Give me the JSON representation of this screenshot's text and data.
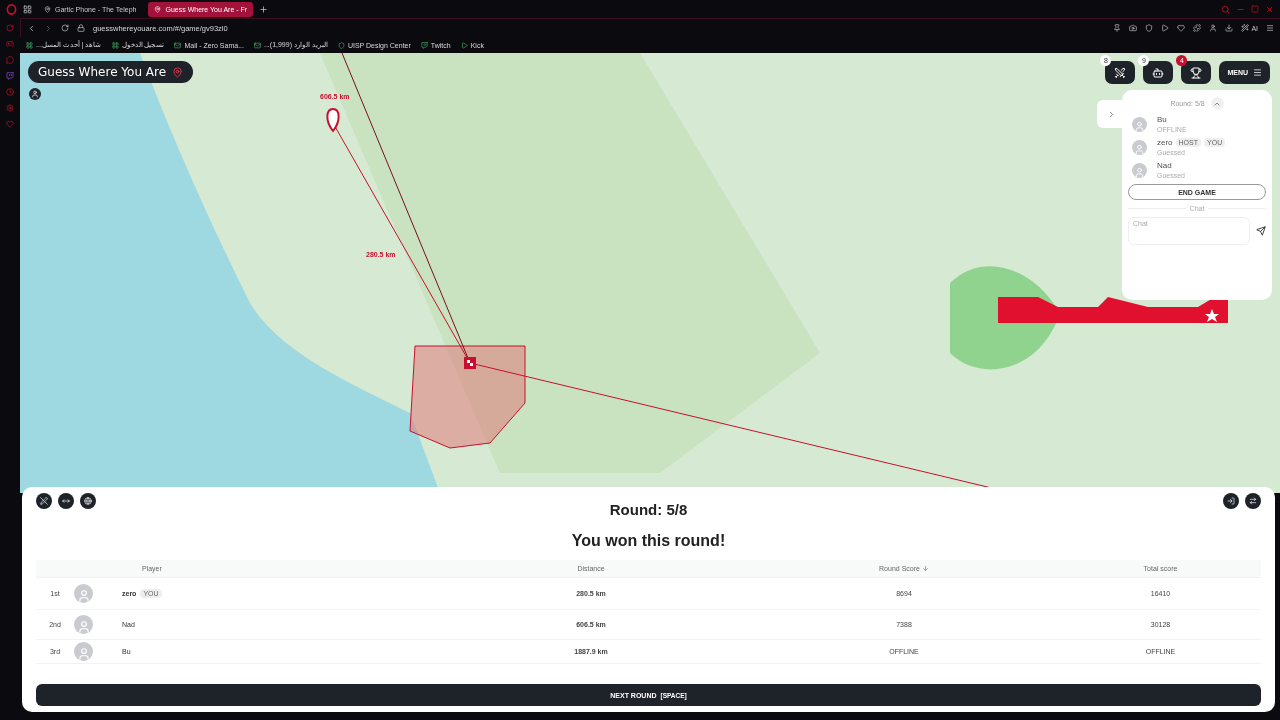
{
  "browser": {
    "tabs": [
      {
        "title": "Gartic Phone - The Teleph",
        "selected": false
      },
      {
        "title": "Guess Where You Are - Fr",
        "selected": true
      }
    ],
    "url": "guesswhereyouare.com/#/game/gv93zl0",
    "ai_label": "AI",
    "bookmarks": [
      "شاهد | أحدث المسل...",
      "تسجيل الدخول",
      "Mail - Zero Sama...",
      "البريد الوارد (1,999)...",
      "UISP Design Center",
      "Twitch",
      "Kick"
    ]
  },
  "game": {
    "title": "Guess Where You Are",
    "map": {
      "distance_labels": [
        "606.5 km",
        "280.5 km"
      ]
    },
    "toolbar": [
      {
        "kind": "swords",
        "badge": "8",
        "alert": false
      },
      {
        "kind": "robot",
        "badge": "9",
        "alert": false
      },
      {
        "kind": "trophy",
        "badge": "4",
        "alert": true
      }
    ],
    "menu_label": "MENU",
    "side_panel": {
      "round": "Round: 5/8",
      "players": [
        {
          "name": "Bu",
          "status": "OFFLINE"
        },
        {
          "name": "zero",
          "tags": [
            "HOST",
            "YOU"
          ],
          "status": "Guessed"
        },
        {
          "name": "Nad",
          "status": "Guessed"
        }
      ],
      "end_game": "END GAME",
      "chat_divider": "Chat",
      "chat_placeholder": "Chat"
    }
  },
  "results": {
    "round": "Round: 5/8",
    "message": "You won this round!",
    "columns": [
      {
        "label": "Player",
        "sorted": false
      },
      {
        "label": "Distance",
        "sorted": false
      },
      {
        "label": "Round Score",
        "sorted": true
      },
      {
        "label": "Total score",
        "sorted": false
      }
    ],
    "rows": [
      {
        "rank": "1st",
        "name": "zero",
        "tags": [
          "YOU"
        ],
        "current": true,
        "distance": "280.5 km",
        "round_score": "8694",
        "total_score": "16410"
      },
      {
        "rank": "2nd",
        "name": "Nad",
        "current": false,
        "distance": "606.5 km",
        "round_score": "7388",
        "total_score": "30128"
      },
      {
        "rank": "3rd",
        "name": "Bu",
        "current": false,
        "distance": "1887.9 km",
        "round_score": "OFFLINE",
        "total_score": "OFFLINE"
      }
    ],
    "next_button": {
      "label": "NEXT ROUND",
      "shortcut": "[SPACE]"
    }
  }
}
